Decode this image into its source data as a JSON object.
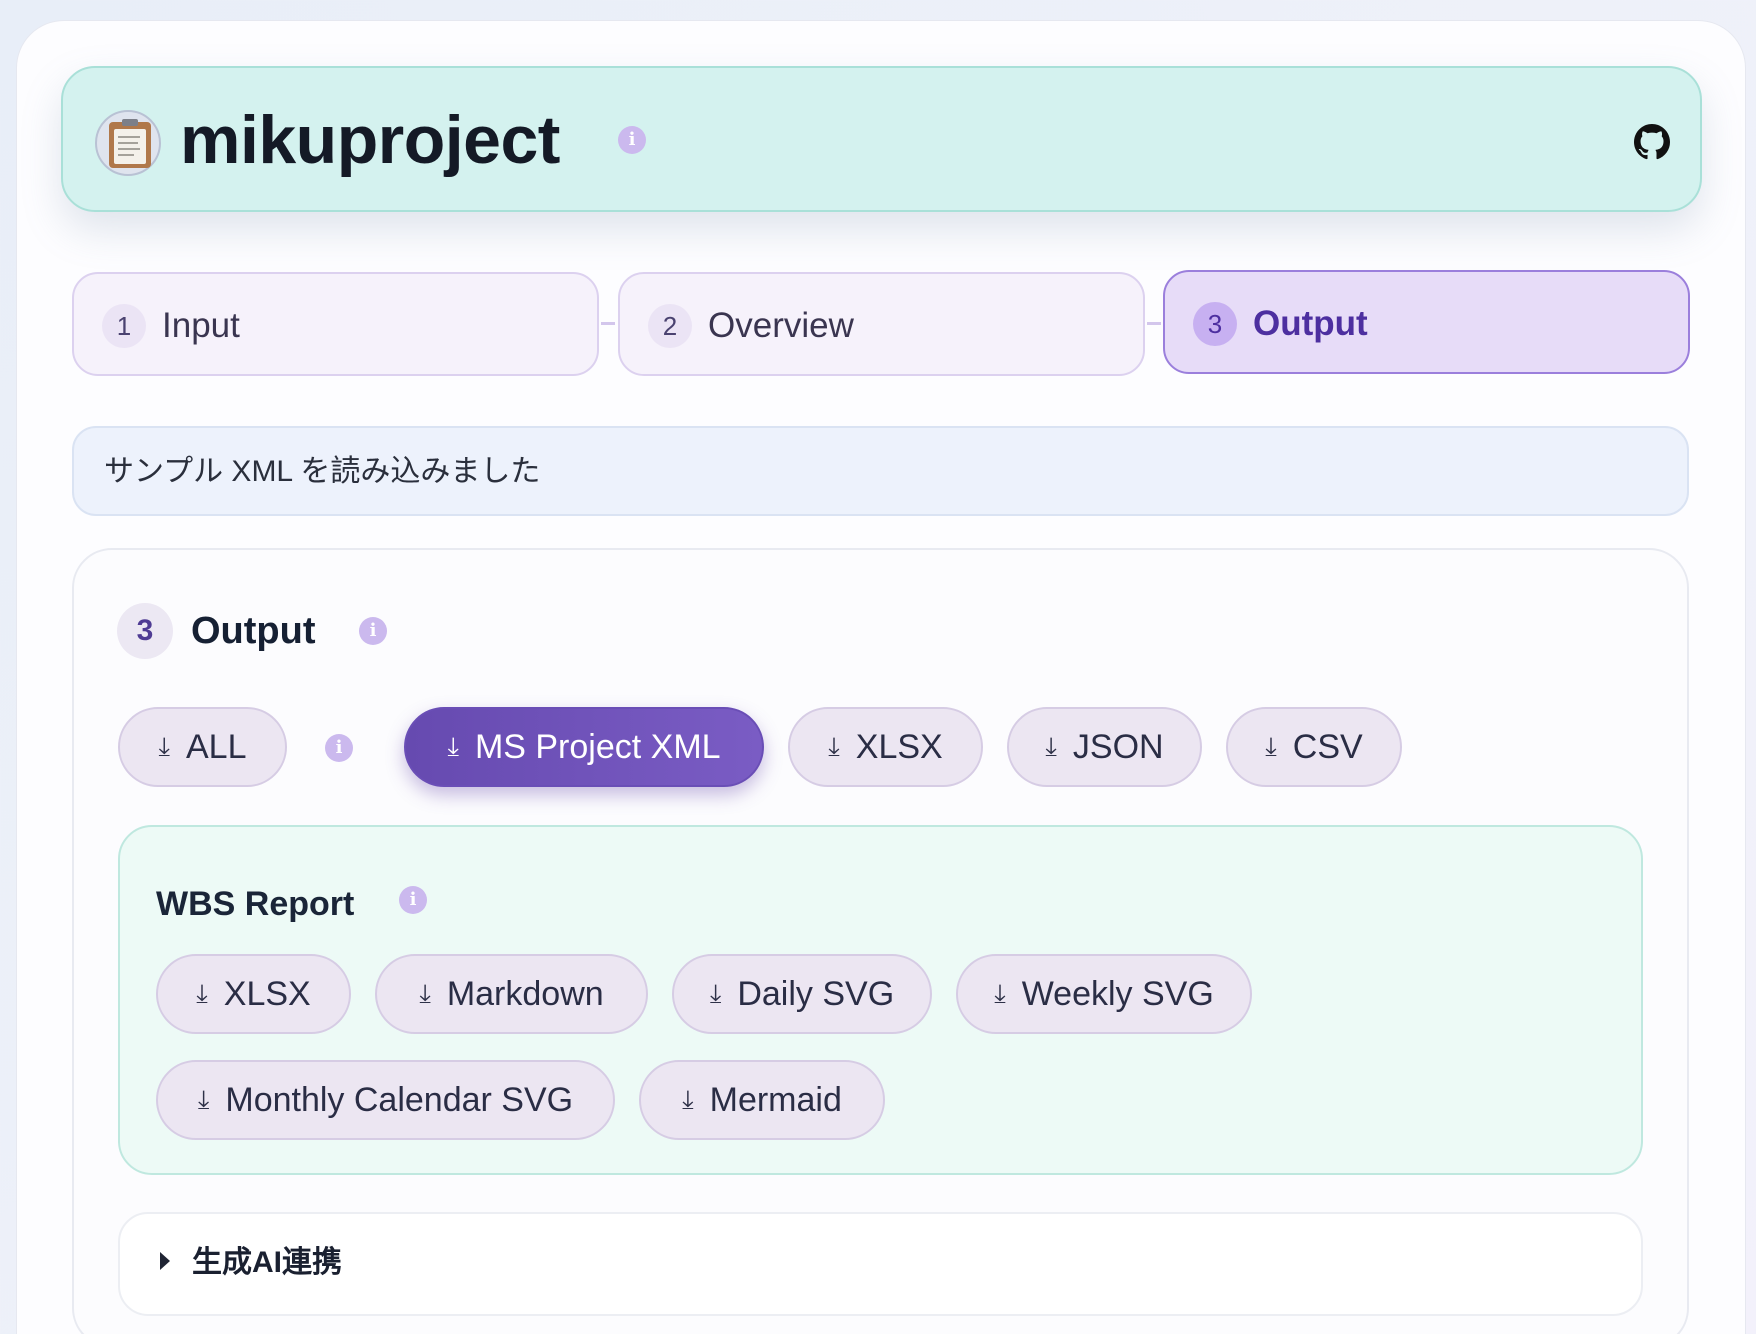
{
  "app": {
    "title": "mikuproject",
    "logo_icon": "clipboard-icon",
    "github_icon": "github-icon"
  },
  "stepper": [
    {
      "num": "1",
      "label": "Input",
      "active": false
    },
    {
      "num": "2",
      "label": "Overview",
      "active": false
    },
    {
      "num": "3",
      "label": "Output",
      "active": true
    }
  ],
  "status_message": "サンプル XML を読み込みました",
  "output": {
    "num": "3",
    "title": "Output",
    "buttons": [
      {
        "label": "ALL",
        "primary": false
      },
      {
        "label": "MS Project XML",
        "primary": true
      },
      {
        "label": "XLSX",
        "primary": false
      },
      {
        "label": "JSON",
        "primary": false
      },
      {
        "label": "CSV",
        "primary": false
      }
    ]
  },
  "wbs_report": {
    "title": "WBS Report",
    "buttons": [
      {
        "label": "XLSX"
      },
      {
        "label": "Markdown"
      },
      {
        "label": "Daily SVG"
      },
      {
        "label": "Weekly SVG"
      },
      {
        "label": "Monthly Calendar SVG"
      },
      {
        "label": "Mermaid"
      }
    ]
  },
  "ai_section": {
    "label": "生成AI連携",
    "expanded": false
  },
  "colors": {
    "accent": "#6b4fb5",
    "header_bg": "#d4f2ef",
    "wbs_bg": "#edfaf6"
  },
  "icons": {
    "info": "i",
    "download": "⤓"
  }
}
